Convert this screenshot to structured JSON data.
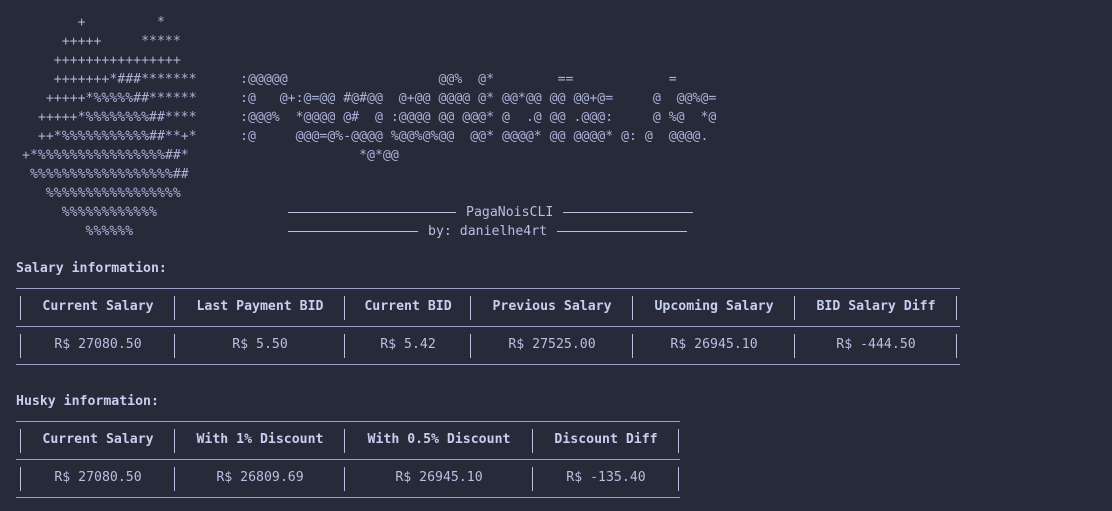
{
  "ascii_art": {
    "left": [
      "       +         *",
      "     +++++     *****",
      "    ++++++++++++++++",
      "    +++++++*###*******",
      "   +++++*%%%%%##******",
      "  +++++*%%%%%%%%##****",
      "  ++*%%%%%%%%%%%##**+*",
      "+*%%%%%%%%%%%%%%%%##*",
      " %%%%%%%%%%%%%%%%%%##",
      "   %%%%%%%%%%%%%%%%%",
      "     %%%%%%%%%%%%",
      "        %%%%%%"
    ],
    "right": [
      "",
      "",
      "",
      ":@@@@@                   @@%  @*        ==            =",
      ":@   @+:@=@@ #@#@@  @+@@ @@@@ @* @@*@@ @@ @@+@=     @  @@%@=",
      ":@@@%  *@@@@ @#  @ :@@@@ @@ @@@* @  .@ @@ .@@@:     @ %@  *@",
      ":@     @@@=@%-@@@@ %@@%@%@@  @@* @@@@* @@ @@@@* @: @  @@@@.",
      "               *@*@@"
    ]
  },
  "banner": {
    "app_name": "PagaNoisCLI",
    "author": "by: danielhe4rt"
  },
  "salary": {
    "label": "Salary information:",
    "headers": [
      "Current Salary",
      "Last Payment BID",
      "Current BID",
      "Previous Salary",
      "Upcoming Salary",
      "BID Salary Diff"
    ],
    "values": [
      "R$ 27080.50",
      "R$ 5.50",
      "R$ 5.42",
      "R$ 27525.00",
      "R$ 26945.10",
      "R$ -444.50"
    ]
  },
  "husky": {
    "label": "Husky information:",
    "headers": [
      "Current Salary",
      "With 1% Discount",
      "With 0.5% Discount",
      "Discount Diff"
    ],
    "values": [
      "R$ 27080.50",
      "R$ 26809.69",
      "R$ 26945.10",
      "R$ -135.40"
    ]
  },
  "colors": {
    "background": "#272a39",
    "foreground": "#b8bfe2"
  }
}
